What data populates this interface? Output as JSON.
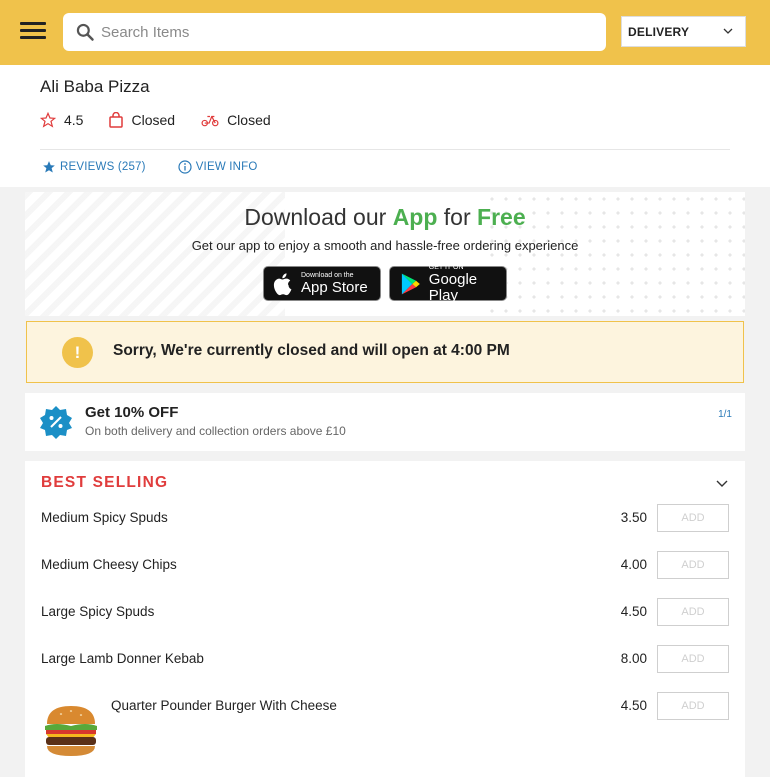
{
  "header": {
    "search_placeholder": "Search Items",
    "order_mode": "DELIVERY"
  },
  "shop": {
    "name": "Ali Baba Pizza",
    "rating": "4.5",
    "collection_status": "Closed",
    "delivery_status": "Closed",
    "reviews_label": "REVIEWS (257)",
    "view_info_label": "VIEW INFO"
  },
  "app_banner": {
    "title_prefix": "Download our ",
    "title_app": "App",
    "title_mid": " for ",
    "title_free": "Free",
    "subtitle": "Get our app to enjoy a smooth and hassle-free ordering experience",
    "appstore_small": "Download on the",
    "appstore_big": "App Store",
    "gplay_small": "GET IT ON",
    "gplay_big": "Google Play"
  },
  "closed_notice": {
    "icon": "!",
    "text": "Sorry, We're currently closed and will open at 4:00 PM"
  },
  "offer": {
    "title": "Get 10% OFF",
    "description": "On both delivery and collection orders above £10",
    "pager": "1/1"
  },
  "menu": {
    "category": "BEST SELLING",
    "add_label": "ADD",
    "items": [
      {
        "name": "Medium Spicy Spuds",
        "price": "3.50"
      },
      {
        "name": "Medium Cheesy Chips",
        "price": "4.00"
      },
      {
        "name": "Large Spicy Spuds",
        "price": "4.50"
      },
      {
        "name": "Large Lamb Donner Kebab",
        "price": "8.00"
      },
      {
        "name": "Quarter Pounder Burger With Cheese",
        "price": "4.50"
      }
    ]
  },
  "colors": {
    "header_bg": "#f0c24b",
    "link_blue": "#2a7ab8",
    "category_red": "#e03c3c",
    "app_green": "#4caf50",
    "notice_bg": "#fdf4de"
  }
}
